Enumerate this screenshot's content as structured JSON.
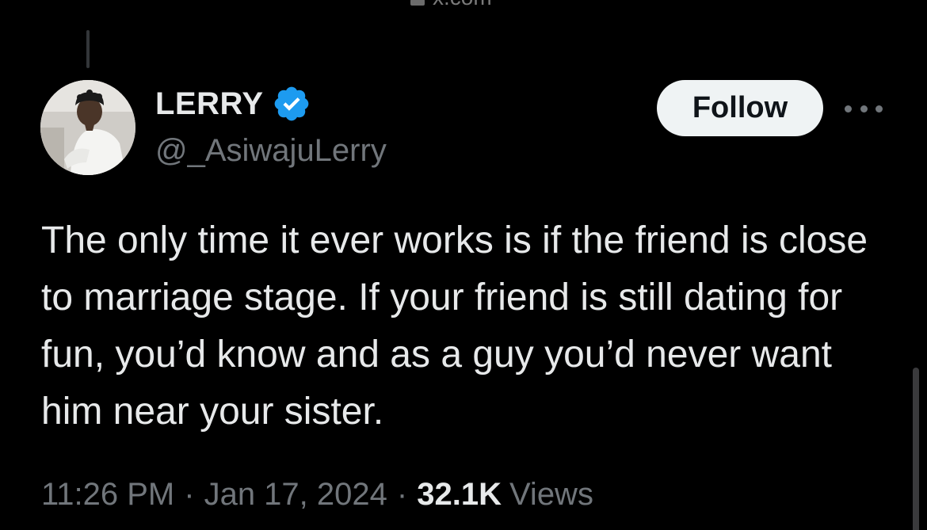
{
  "browser": {
    "url": "x.com"
  },
  "tweet": {
    "author": {
      "display_name": "LERRY",
      "handle": "@_AsiwajuLerry",
      "verified": true,
      "verified_color": "#1d9bf0"
    },
    "follow_label": "Follow",
    "text": "The only time it ever works is if the friend is close to marriage stage. If your friend is still dating for fun, you’d know and as a guy you’d never want him near your sister.",
    "time": "11:26 PM",
    "separator": "·",
    "date": "Jan 17, 2024",
    "views_count": "32.1K",
    "views_label": "Views"
  },
  "colors": {
    "background": "#000000",
    "primary_text": "#e7e9ea",
    "secondary_text": "#71767b",
    "follow_button_bg": "#eff3f4"
  },
  "icons": {
    "verified": "verified-badge-icon",
    "more": "more-options-icon",
    "lock": "lock-icon"
  }
}
